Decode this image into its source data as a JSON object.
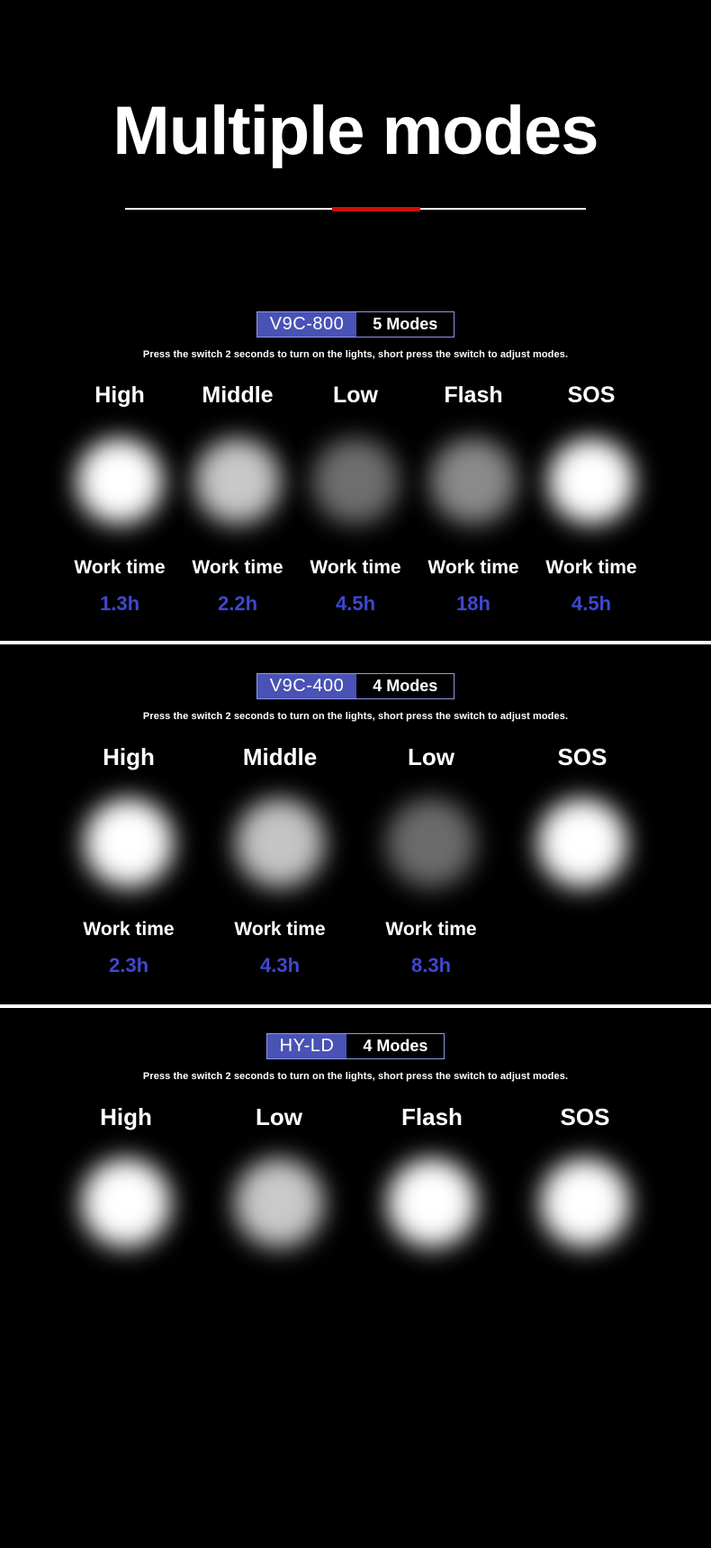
{
  "header": {
    "title": "Multiple modes",
    "divider_color": "#ffffff",
    "accent_color": "#cc0d0d"
  },
  "instruction_text": "Press the switch 2 seconds to turn on the lights, short press the switch to adjust modes.",
  "colors": {
    "badge_blue": "#4952b5",
    "worktime_blue": "#3e48d0",
    "background": "#000000",
    "text": "#ffffff"
  },
  "sections": [
    {
      "model": "V9C-800",
      "modes_count_label": "5 Modes",
      "instruction": "Press the switch 2 seconds to turn on the lights, short press the switch to adjust modes.",
      "modes": [
        {
          "name": "High",
          "worktime_label": "Work time",
          "worktime": "1.3h",
          "brightness": "#ffffff"
        },
        {
          "name": "Middle",
          "worktime_label": "Work time",
          "worktime": "2.2h",
          "brightness": "#c8c8c8"
        },
        {
          "name": "Low",
          "worktime_label": "Work time",
          "worktime": "4.5h",
          "brightness": "#6e6e6e"
        },
        {
          "name": "Flash",
          "worktime_label": "Work time",
          "worktime": "18h",
          "brightness": "#8a8a8a"
        },
        {
          "name": "SOS",
          "worktime_label": "Work time",
          "worktime": "4.5h",
          "brightness": "#ffffff"
        }
      ]
    },
    {
      "model": "V9C-400",
      "modes_count_label": "4 Modes",
      "instruction": "Press the switch 2 seconds to turn on the lights, short press the switch to adjust modes.",
      "modes": [
        {
          "name": "High",
          "worktime_label": "Work time",
          "worktime": "2.3h",
          "brightness": "#ffffff"
        },
        {
          "name": "Middle",
          "worktime_label": "Work time",
          "worktime": "4.3h",
          "brightness": "#c4c4c4"
        },
        {
          "name": "Low",
          "worktime_label": "Work time",
          "worktime": "8.3h",
          "brightness": "#6b6b6b"
        },
        {
          "name": "SOS",
          "worktime_label": "",
          "worktime": "",
          "brightness": "#ffffff"
        }
      ]
    },
    {
      "model": "HY-LD",
      "modes_count_label": "4 Modes",
      "instruction": "Press the switch 2 seconds to turn on the lights, short press the switch to adjust modes.",
      "modes": [
        {
          "name": "High",
          "worktime_label": "",
          "worktime": "",
          "brightness": "#ffffff"
        },
        {
          "name": "Low",
          "worktime_label": "",
          "worktime": "",
          "brightness": "#c9c9c9"
        },
        {
          "name": "Flash",
          "worktime_label": "",
          "worktime": "",
          "brightness": "#ffffff"
        },
        {
          "name": "SOS",
          "worktime_label": "",
          "worktime": "",
          "brightness": "#ffffff"
        }
      ]
    }
  ]
}
